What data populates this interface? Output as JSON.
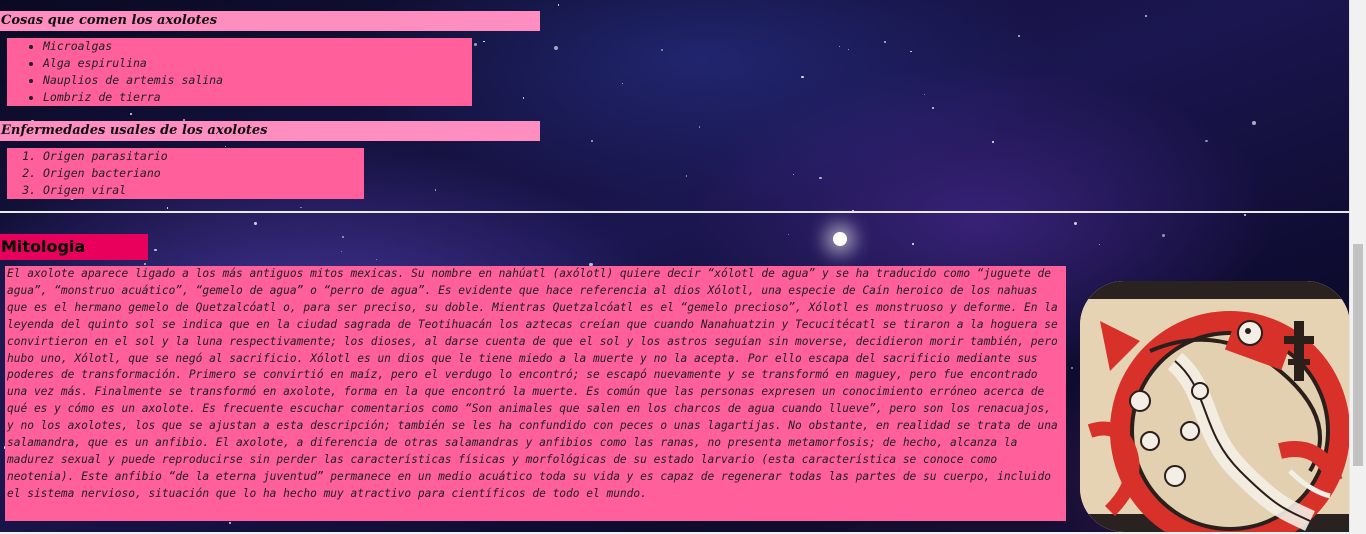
{
  "food_section": {
    "title": "Cosas que comen los axolotes",
    "items": [
      "Microalgas",
      "Alga espirulina",
      "Nauplios de artemis salina",
      "Lombriz de tierra"
    ]
  },
  "disease_section": {
    "title": "Enfermedades usales de los axolotes",
    "items": [
      "Origen parasitario",
      "Origen bacteriano",
      "Origen viral"
    ]
  },
  "mythology": {
    "title": "Mitologia",
    "text": "El axolote aparece ligado a los más antiguos mitos mexicas. Su nombre en nahúatl (axólotl) quiere decir “xólotl de agua” y se ha traducido como “juguete de agua”, “monstruo acuático”, “gemelo de agua” o “perro de agua”. Es evidente que hace referencia al dios Xólotl, una especie de Caín heroico de los nahuas que es el hermano gemelo de Quetzalcóatl o, para ser preciso, su doble. Mientras Quetzalcóatl es el “gemelo precioso”, Xólotl es monstruoso y deforme. En la leyenda del quinto sol se indica que en la ciudad sagrada de Teotihuacán los aztecas creían que cuando Nanahuatzin y Tecucitécatl se tiraron a la hoguera se convirtieron en el sol y la luna respectivamente; los dioses, al darse cuenta de que el sol y los astros seguían sin moverse, decidieron morir también, pero hubo uno, Xólotl, que se negó al sacrificio. Xólotl es un dios que le tiene miedo a la muerte y no la acepta. Por ello escapa del sacrificio mediante sus poderes de transformación. Primero se convirtió en maíz, pero el verdugo lo encontró; se escapó nuevamente y se transformó en maguey, pero fue encontrado una vez más. Finalmente se transformó en axolote, forma en la que encontró la muerte. Es común que las personas expresen un conocimiento erróneo acerca de qué es y cómo es un axolote. Es frecuente escuchar comentarios como “Son animales que salen en los charcos de agua cuando llueve”, pero son los renacuajos, y no los axolotes, los que se ajustan a esta descripción; también se les ha confundido con peces o unas lagartijas. No obstante, en realidad se trata de una salamandra, que es un anfibio. El axolote, a diferencia de otras salamandras y anfibios como las ranas, no presenta metamorfosis; de hecho, alcanza la madurez sexual y puede reproducirse sin perder las características físicas y morfológicas de su estado larvario (esta característica se conoce como neotenia). Este anfibio “de la eterna juventud” permanece en un medio acuático toda su vida y es capaz de regenerar todas las partes de su cuerpo, incluido el sistema nervioso, situación que lo ha hecho muy atractivo para científicos de todo el mundo."
  },
  "image": {
    "icon": "xolotl-codex-illustration"
  },
  "colors": {
    "title_bg": "#ff8ec0",
    "box_bg": "#ff5f9b",
    "mythology_title_bg": "#e8005c"
  }
}
